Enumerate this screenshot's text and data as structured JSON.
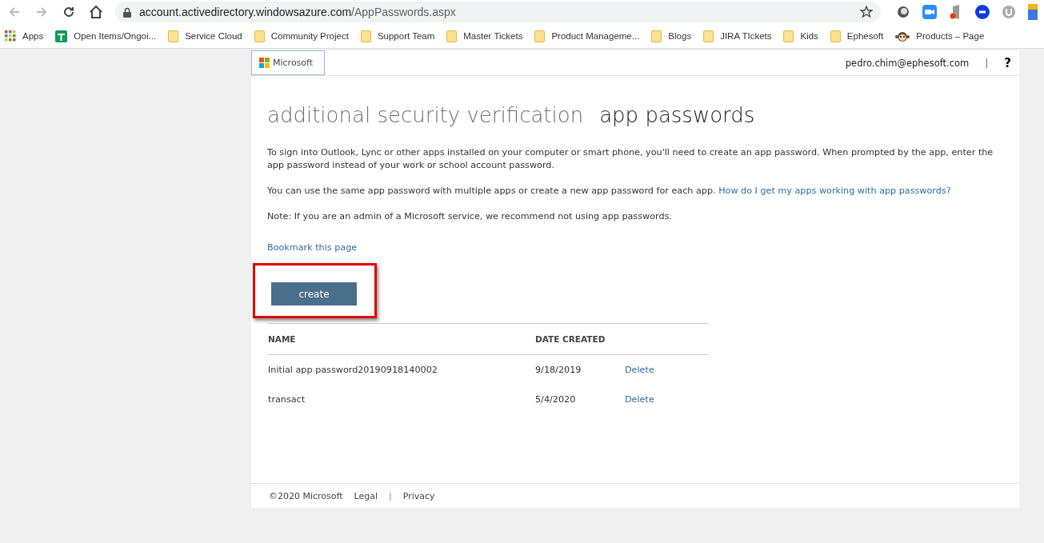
{
  "browser": {
    "url_host": "account.activedirectory.windowsazure.com",
    "url_path": "/AppPasswords.aspx",
    "bookmarks": [
      {
        "label": "Apps",
        "kind": "apps"
      },
      {
        "label": "Open Items/Ongoi...",
        "kind": "sheet"
      },
      {
        "label": "Service Cloud",
        "kind": "folder"
      },
      {
        "label": "Community Project",
        "kind": "folder"
      },
      {
        "label": "Support Team",
        "kind": "folder"
      },
      {
        "label": "Master Tickets",
        "kind": "folder"
      },
      {
        "label": "Product Manageme...",
        "kind": "folder"
      },
      {
        "label": "Blogs",
        "kind": "folder"
      },
      {
        "label": "JIRA TIckets",
        "kind": "folder"
      },
      {
        "label": "Kids",
        "kind": "folder"
      },
      {
        "label": "Ephesoft",
        "kind": "folder"
      },
      {
        "label": "Products – Page",
        "kind": "site"
      }
    ]
  },
  "header": {
    "logo": "Microsoft",
    "user": "pedro.chim@ephesoft.com",
    "separator": "|",
    "help": "?"
  },
  "title": {
    "section": "additional security verification",
    "page": "app passwords"
  },
  "paragraphs": [
    {
      "text": "To sign into Outlook, Lync or other apps installed on your computer or smart phone, you'll need to create an app password. When prompted by the app, enter the app password instead of your work or school account password."
    },
    {
      "text": "You can use the same app password with multiple apps or create a new app password for each app.",
      "link": "How do I get my apps working with app passwords?"
    },
    {
      "text": "Note: If you are an admin of a Microsoft service, we recommend not using app passwords."
    }
  ],
  "bookmark_link": "Bookmark this page",
  "create_button": "create",
  "table": {
    "columns": [
      "NAME",
      "DATE CREATED"
    ],
    "rows": [
      {
        "name": "Initial app password20190918140002",
        "date": "9/18/2019",
        "action": "Delete"
      },
      {
        "name": "transact",
        "date": "5/4/2020",
        "action": "Delete"
      }
    ]
  },
  "footer": {
    "copyright": "©2020 Microsoft",
    "links": [
      "Legal",
      "Privacy"
    ],
    "separator": "|"
  }
}
